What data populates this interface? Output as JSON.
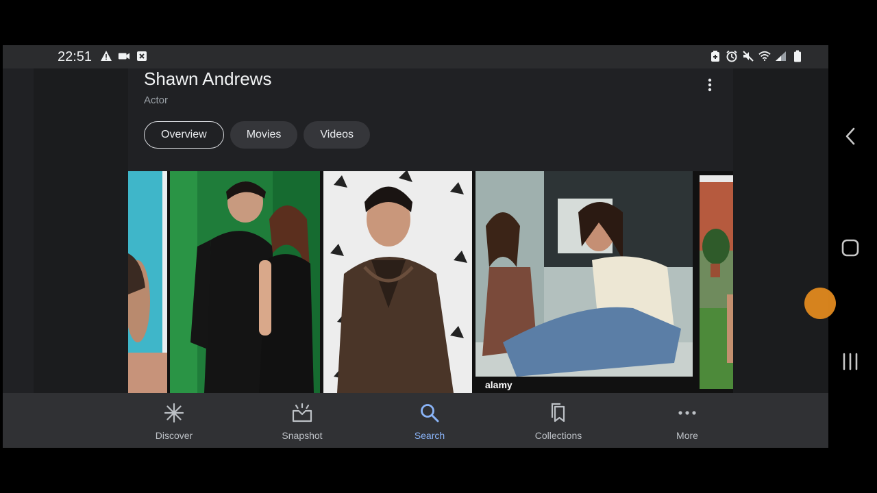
{
  "status": {
    "time": "22:51",
    "left_icons": [
      "warning-icon",
      "video-camera-icon",
      "close-box-icon"
    ],
    "right_icons": [
      "battery-saver-icon",
      "alarm-icon",
      "mute-icon",
      "wifi-icon",
      "signal-icon",
      "battery-icon"
    ]
  },
  "entity": {
    "name": "Shawn Andrews",
    "subtitle": "Actor"
  },
  "tabs": [
    {
      "label": "Overview",
      "active": true
    },
    {
      "label": "Movies",
      "active": false
    },
    {
      "label": "Videos",
      "active": false
    }
  ],
  "images": [
    {
      "name": "image-1"
    },
    {
      "name": "image-2"
    },
    {
      "name": "image-3"
    },
    {
      "name": "image-4",
      "watermark": "alamy"
    },
    {
      "name": "image-5"
    }
  ],
  "bottom_nav": [
    {
      "label": "Discover",
      "icon": "asterisk-icon"
    },
    {
      "label": "Snapshot",
      "icon": "snapshot-icon"
    },
    {
      "label": "Search",
      "icon": "search-icon",
      "active": true
    },
    {
      "label": "Collections",
      "icon": "bookmarks-icon"
    },
    {
      "label": "More",
      "icon": "more-horiz-icon"
    }
  ],
  "colors": {
    "accent": "#8ab4f8",
    "background": "#202124",
    "nav_bg": "#303134"
  }
}
